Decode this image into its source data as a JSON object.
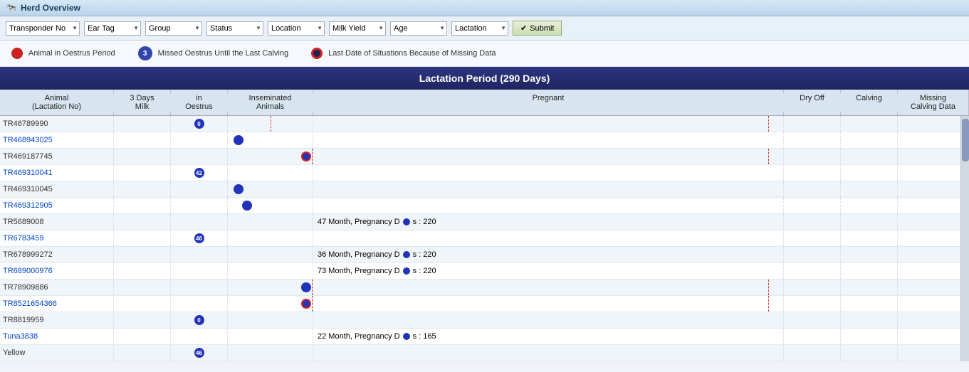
{
  "titleBar": {
    "icon": "🐄",
    "title": "Herd Overview"
  },
  "filters": {
    "transponderLabel": "Transponder No",
    "earTagLabel": "Ear Tag",
    "groupLabel": "Group",
    "statusLabel": "Status",
    "locationLabel": "Location",
    "milkYieldLabel": "Milk Yield",
    "ageLabel": "Age",
    "lactationLabel": "Lactation",
    "submitLabel": "Submit"
  },
  "legend": {
    "item1": "Animal in Oestrus Period",
    "item2Badge": "3",
    "item2": "Missed Oestrus Until the Last Calving",
    "item3": "Last Date of Situations Because of Missing Data"
  },
  "sectionHeader": "Lactation Period (290 Days)",
  "columns": [
    "Animal (Lactation No)",
    "3 Days Milk",
    "in Oestrus",
    "Inseminated Animals",
    "Pregnant",
    "Dry Off",
    "Calving",
    "Missing Calving Data"
  ],
  "rows": [
    {
      "id": "TR46789990",
      "linked": false,
      "milk": "",
      "oestrus": "0",
      "oestrusHasNum": true,
      "inseminated": "",
      "pregnant": "",
      "dryOff": "",
      "calving": "",
      "missingCalving": ""
    },
    {
      "id": "TR468943025",
      "linked": true,
      "milk": "",
      "oestrus": "",
      "inseminated": "●",
      "inseminatedDot": true,
      "pregnant": "",
      "dryOff": "",
      "calving": "",
      "missingCalving": ""
    },
    {
      "id": "TR469187745",
      "linked": false,
      "milk": "",
      "oestrus": "",
      "inseminated": "◉",
      "inseminatedOutlined": true,
      "pregnant": "",
      "dryOff": "",
      "calving": "",
      "missingCalving": ""
    },
    {
      "id": "TR469310041",
      "linked": true,
      "milk": "",
      "oestrus": "42",
      "oestrusHasNum": true,
      "inseminated": "",
      "pregnant": "",
      "dryOff": "",
      "calving": "",
      "missingCalving": ""
    },
    {
      "id": "TR469310045",
      "linked": false,
      "milk": "",
      "oestrus": "",
      "inseminated": "●",
      "inseminatedDot": true,
      "pregnant": "",
      "dryOff": "",
      "calving": "",
      "missingCalving": ""
    },
    {
      "id": "TR469312905",
      "linked": true,
      "milk": "",
      "oestrus": "",
      "inseminated": "●",
      "inseminatedDot": true,
      "pregnant": "",
      "dryOff": "",
      "calving": "",
      "missingCalving": ""
    },
    {
      "id": "TR5689008",
      "linked": false,
      "milk": "",
      "oestrus": "",
      "inseminated": "",
      "pregnant": "47 Month, Pregnancy Days : 220",
      "pregnantDot": true,
      "dryOff": "",
      "calving": "",
      "missingCalving": ""
    },
    {
      "id": "TR6783459",
      "linked": true,
      "milk": "",
      "oestrus": "46",
      "oestrusHasNum": true,
      "inseminated": "",
      "pregnant": "",
      "dryOff": "",
      "calving": "",
      "missingCalving": ""
    },
    {
      "id": "TR678999272",
      "linked": false,
      "milk": "",
      "oestrus": "",
      "inseminated": "",
      "pregnant": "36 Month, Pregnancy Days : 220",
      "pregnantDot": true,
      "dryOff": "",
      "calving": "",
      "missingCalving": ""
    },
    {
      "id": "TR689000976",
      "linked": true,
      "milk": "",
      "oestrus": "",
      "inseminated": "",
      "pregnant": "73 Month, Pregnancy Days : 220",
      "pregnantDot": true,
      "dryOff": "",
      "calving": "",
      "missingCalving": ""
    },
    {
      "id": "TR78909886",
      "linked": false,
      "milk": "",
      "oestrus": "",
      "inseminated": "●",
      "inseminatedDot": true,
      "pregnant": "",
      "dryOff": "",
      "calving": "",
      "missingCalving": ""
    },
    {
      "id": "TR8521654366",
      "linked": true,
      "milk": "",
      "oestrus": "",
      "inseminated": "◉",
      "inseminatedOutlined": true,
      "pregnant": "",
      "dryOff": "",
      "calving": "",
      "missingCalving": ""
    },
    {
      "id": "TR8819959",
      "linked": false,
      "milk": "",
      "oestrus": "0",
      "oestrusHasNum": true,
      "inseminated": "",
      "pregnant": "",
      "dryOff": "",
      "calving": "",
      "missingCalving": ""
    },
    {
      "id": "Tuna3838",
      "linked": true,
      "milk": "",
      "oestrus": "",
      "inseminated": "",
      "pregnant": "22 Month, Pregnancy Days : 165",
      "pregnantDot": true,
      "dryOff": "",
      "calving": "",
      "missingCalving": ""
    },
    {
      "id": "Yellow",
      "linked": false,
      "milk": "",
      "oestrus": "46",
      "oestrusHasNum": true,
      "inseminated": "",
      "pregnant": "",
      "dryOff": "",
      "calving": "",
      "missingCalving": ""
    }
  ]
}
